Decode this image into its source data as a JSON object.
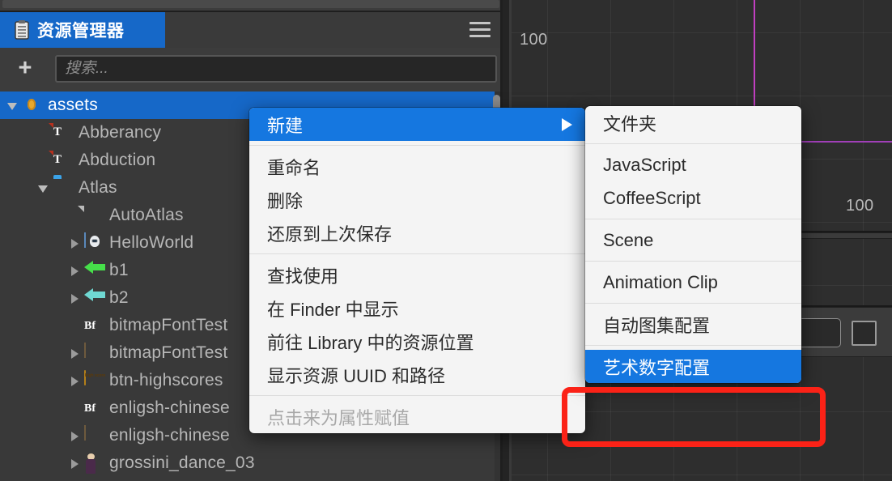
{
  "window": {
    "scene_labels": [
      "100",
      "100"
    ],
    "guide_color": "#c13fc1"
  },
  "assets_panel": {
    "tab": {
      "label": "资源管理器",
      "icon": "clipboard-icon"
    },
    "menu_icon": "hamburger-icon",
    "add_button": "+",
    "search": {
      "placeholder": "搜索...",
      "value": ""
    },
    "tree": [
      {
        "label": "assets",
        "indent": 0,
        "twisty": "open",
        "icon": "folder-yellow-icon",
        "selected": true
      },
      {
        "label": "Abberancy",
        "indent": 1,
        "twisty": "none",
        "icon": "text-asset-icon",
        "selected": false
      },
      {
        "label": "Abduction",
        "indent": 1,
        "twisty": "none",
        "icon": "text-asset-icon",
        "selected": false
      },
      {
        "label": "Atlas",
        "indent": 1,
        "twisty": "open",
        "icon": "folder-blue-icon",
        "selected": false
      },
      {
        "label": "AutoAtlas",
        "indent": 2,
        "twisty": "none",
        "icon": "document-icon",
        "selected": false
      },
      {
        "label": "HelloWorld",
        "indent": 2,
        "twisty": "closed",
        "icon": "sprite-icon",
        "selected": false
      },
      {
        "label": "b1",
        "indent": 2,
        "twisty": "closed",
        "icon": "arrow-green-icon",
        "selected": false
      },
      {
        "label": "b2",
        "indent": 2,
        "twisty": "closed",
        "icon": "arrow-cyan-icon",
        "selected": false
      },
      {
        "label": "bitmapFontTest",
        "indent": 2,
        "twisty": "none",
        "icon": "bitmap-font-icon",
        "selected": false
      },
      {
        "label": "bitmapFontTest",
        "indent": 2,
        "twisty": "closed",
        "icon": "font-strip-icon",
        "selected": false
      },
      {
        "label": "btn-highscores",
        "indent": 2,
        "twisty": "closed",
        "icon": "pill-sprite-icon",
        "selected": false
      },
      {
        "label": "enligsh-chinese",
        "indent": 2,
        "twisty": "none",
        "icon": "bitmap-font-icon",
        "selected": false
      },
      {
        "label": "enligsh-chinese",
        "indent": 2,
        "twisty": "closed",
        "icon": "font-strip-icon",
        "selected": false
      },
      {
        "label": "grossini_dance_03",
        "indent": 2,
        "twisty": "closed",
        "icon": "person-sprite-icon",
        "selected": false
      }
    ]
  },
  "context_menu": {
    "groups": [
      [
        {
          "label": "新建",
          "highlighted": true,
          "submenu": true,
          "disabled": false
        }
      ],
      [
        {
          "label": "重命名",
          "highlighted": false,
          "submenu": false,
          "disabled": false
        },
        {
          "label": "删除",
          "highlighted": false,
          "submenu": false,
          "disabled": false
        },
        {
          "label": "还原到上次保存",
          "highlighted": false,
          "submenu": false,
          "disabled": false
        }
      ],
      [
        {
          "label": "查找使用",
          "highlighted": false,
          "submenu": false,
          "disabled": false
        },
        {
          "label": "在 Finder 中显示",
          "highlighted": false,
          "submenu": false,
          "disabled": false
        },
        {
          "label": "前往 Library 中的资源位置",
          "highlighted": false,
          "submenu": false,
          "disabled": false
        },
        {
          "label": "显示资源 UUID 和路径",
          "highlighted": false,
          "submenu": false,
          "disabled": false
        }
      ],
      [
        {
          "label": "点击来为属性赋值",
          "highlighted": false,
          "submenu": false,
          "disabled": true
        }
      ]
    ]
  },
  "submenu": {
    "groups": [
      [
        {
          "label": "文件夹",
          "highlighted": false
        }
      ],
      [
        {
          "label": "JavaScript",
          "highlighted": false
        },
        {
          "label": "CoffeeScript",
          "highlighted": false
        }
      ],
      [
        {
          "label": "Scene",
          "highlighted": false
        }
      ],
      [
        {
          "label": "Animation Clip",
          "highlighted": false
        }
      ],
      [
        {
          "label": "自动图集配置",
          "highlighted": false
        }
      ],
      [
        {
          "label": "艺术数字配置",
          "highlighted": true
        }
      ]
    ]
  },
  "annotation": {
    "highlight_color": "#fb2217",
    "target": "艺术数字配置"
  }
}
